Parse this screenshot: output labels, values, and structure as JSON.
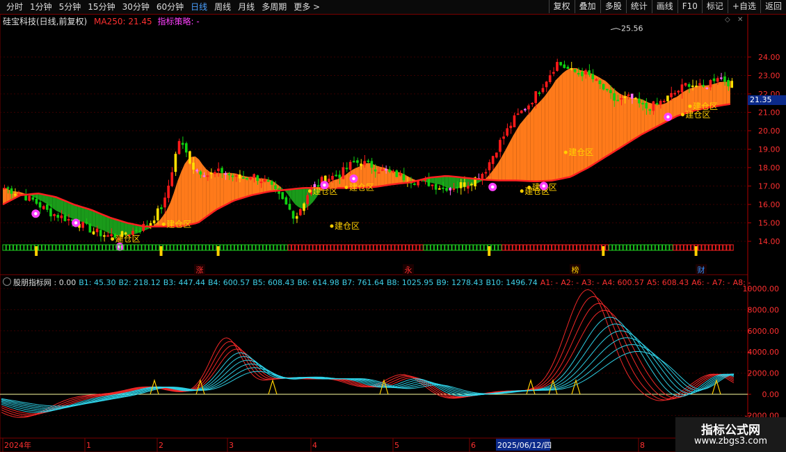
{
  "toolbar": {
    "periods": [
      "分时",
      "1分钟",
      "5分钟",
      "15分钟",
      "30分钟",
      "60分钟",
      "日线",
      "周线",
      "月线",
      "多周期",
      "更多 >"
    ],
    "active_period": "日线",
    "buttons": [
      "复权",
      "叠加",
      "多股",
      "统计",
      "画线",
      "F10",
      "标记",
      "+自选",
      "返回"
    ]
  },
  "main_info": {
    "stock": "硅宝科技(日线,前复权)",
    "ma_label": "MA250: 21.45",
    "strategy_label": "指标策略: -"
  },
  "current_price": "21.35",
  "peak_label": "25.56",
  "build_zone_label": "建仓区",
  "event_labels": [
    {
      "text": "涨",
      "color": "#ff3030"
    },
    {
      "text": "永",
      "color": "#ff3030"
    },
    {
      "text": "榜",
      "color": "#ffd000"
    },
    {
      "text": "财",
      "color": "#3090ff"
    }
  ],
  "indicator_info": {
    "name": "股朋指标网 : 0.00",
    "b_values": [
      "B1: 45.30",
      "B2: 218.12",
      "B3: 447.44",
      "B4: 600.57",
      "B5: 608.43",
      "B6: 614.98",
      "B7: 761.64",
      "B8: 1025.95",
      "B9: 1278.43",
      "B10: 1496.74"
    ],
    "a_values": [
      "A1: -",
      "A2: -",
      "A3: -",
      "A4: 600.57",
      "A5: 608.43",
      "A6: -",
      "A7: -",
      "A8: -"
    ]
  },
  "date_axis": {
    "labels": [
      "2024年",
      "1",
      "2",
      "3",
      "4",
      "5",
      "6",
      "8"
    ],
    "highlight": "2025/06/12/四"
  },
  "watermark": {
    "title": "指标公式网",
    "url": "www.zbgs3.com"
  },
  "colors": {
    "up": "#ff2020",
    "down": "#00c000",
    "ma_line": "#ff2020",
    "band_up": "#ff7a1a",
    "band_down": "#1a9a1a",
    "cyan": "#30d8ee",
    "yellow": "#ffd000",
    "magenta": "#ff40ff"
  },
  "chart_data": [
    {
      "type": "candlestick",
      "title": "硅宝科技(日线,前复权)",
      "y_ticks": [
        14.0,
        15.0,
        16.0,
        17.0,
        18.0,
        19.0,
        20.0,
        21.0,
        22.0,
        23.0,
        24.0
      ],
      "ylim": [
        13.3,
        25.9
      ],
      "grid": true,
      "x_months": [
        "2024年",
        "1",
        "2",
        "3",
        "4",
        "5",
        "6",
        "8"
      ],
      "close_path": [
        16.9,
        16.6,
        16.2,
        15.6,
        15.3,
        15.0,
        14.6,
        14.3,
        14.3,
        14.6,
        15.0,
        16.1,
        19.5,
        18.0,
        17.6,
        17.8,
        17.4,
        17.6,
        17.2,
        16.3,
        15.3,
        16.8,
        17.4,
        17.6,
        18.3,
        18.2,
        17.8,
        17.6,
        17.3,
        17.2,
        16.9,
        17.0,
        17.2,
        17.8,
        19.3,
        20.6,
        21.4,
        22.5,
        23.7,
        23.2,
        23.1,
        22.4,
        21.6,
        21.8,
        21.2,
        21.5,
        22.0,
        22.6,
        22.3,
        23.0,
        22.5
      ],
      "ma250": [
        16.0,
        16.5,
        16.6,
        16.4,
        16.0,
        15.7,
        15.3,
        15.0,
        14.8,
        14.8,
        14.8,
        15.0,
        15.7,
        16.2,
        16.5,
        16.7,
        16.8,
        16.9,
        16.9,
        16.9,
        16.9,
        16.95,
        17.1,
        17.2,
        17.45,
        17.55,
        17.45,
        17.35,
        17.3,
        17.3,
        17.25,
        17.3,
        17.5,
        18.0,
        18.6,
        19.2,
        19.8,
        20.3,
        20.8,
        21.1,
        21.3,
        21.45
      ],
      "build_zone_markers": 9
    },
    {
      "type": "line",
      "title": "股朋指标网",
      "series_count": 10,
      "y_ticks": [
        -2000,
        0,
        2000,
        4000,
        6000,
        8000,
        10000
      ],
      "ylim": [
        -3000,
        11200
      ],
      "peaks": [
        {
          "month_pos": "3",
          "value": 5300
        },
        {
          "month_pos": "7",
          "value": 9900
        }
      ]
    }
  ]
}
